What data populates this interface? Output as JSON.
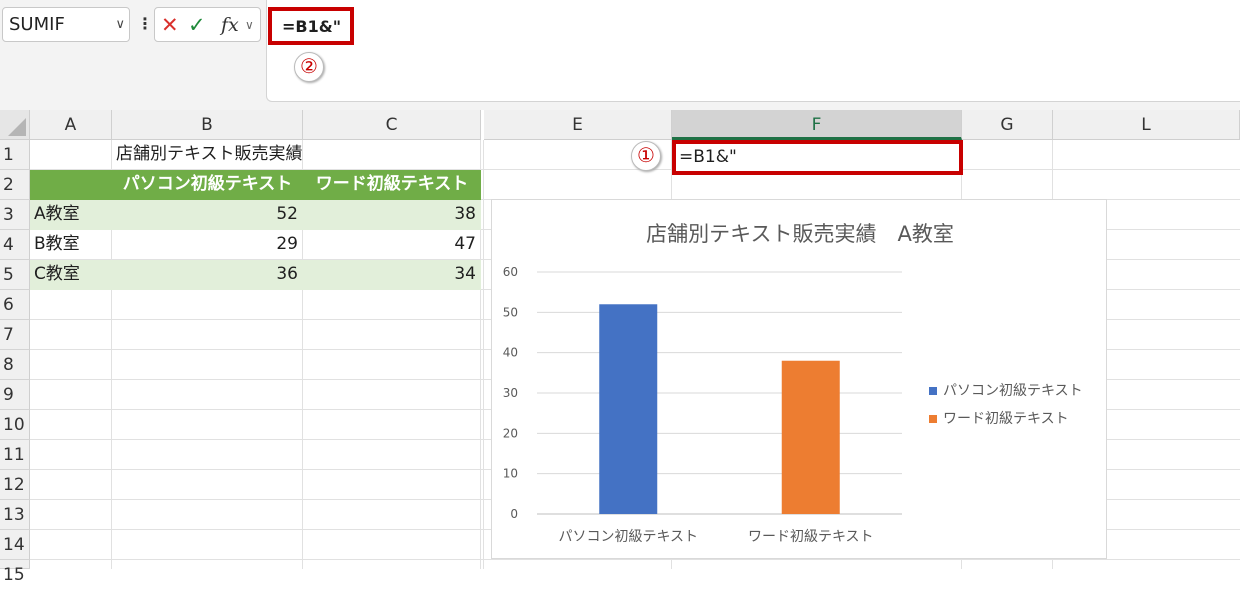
{
  "formula_bar": {
    "name_box": "SUMIF",
    "cancel_icon": "x-icon",
    "enter_icon": "check-icon",
    "fx_label": "fx",
    "formula": "=B1&\"",
    "marker_2": "②"
  },
  "columns": [
    "A",
    "B",
    "C",
    "E",
    "F",
    "G",
    "L"
  ],
  "rows": [
    "1",
    "2",
    "3",
    "4",
    "5",
    "6",
    "7",
    "8",
    "9",
    "10",
    "11",
    "12",
    "13",
    "14",
    "15"
  ],
  "sheet": {
    "b1": "店舗別テキスト販売実績",
    "header_b": "パソコン初級テキスト",
    "header_c": "ワード初級テキスト",
    "data": [
      {
        "name": "A教室",
        "b": "52",
        "c": "38"
      },
      {
        "name": "B教室",
        "b": "29",
        "c": "47"
      },
      {
        "name": "C教室",
        "b": "36",
        "c": "34"
      }
    ],
    "f1": "=B1&\"",
    "marker_1": "①"
  },
  "chart_data": {
    "type": "bar",
    "title": "店舗別テキスト販売実績　A教室",
    "categories": [
      "パソコン初級テキスト",
      "ワード初級テキスト"
    ],
    "series": [
      {
        "name": "パソコン初級テキスト",
        "values": [
          52,
          null
        ],
        "color": "#4472c4"
      },
      {
        "name": "ワード初級テキスト",
        "values": [
          null,
          38
        ],
        "color": "#ed7d31"
      }
    ],
    "yticks": [
      "0",
      "10",
      "20",
      "30",
      "40",
      "50",
      "60"
    ],
    "ylim": [
      0,
      60
    ],
    "grid": true,
    "legend": "right"
  }
}
